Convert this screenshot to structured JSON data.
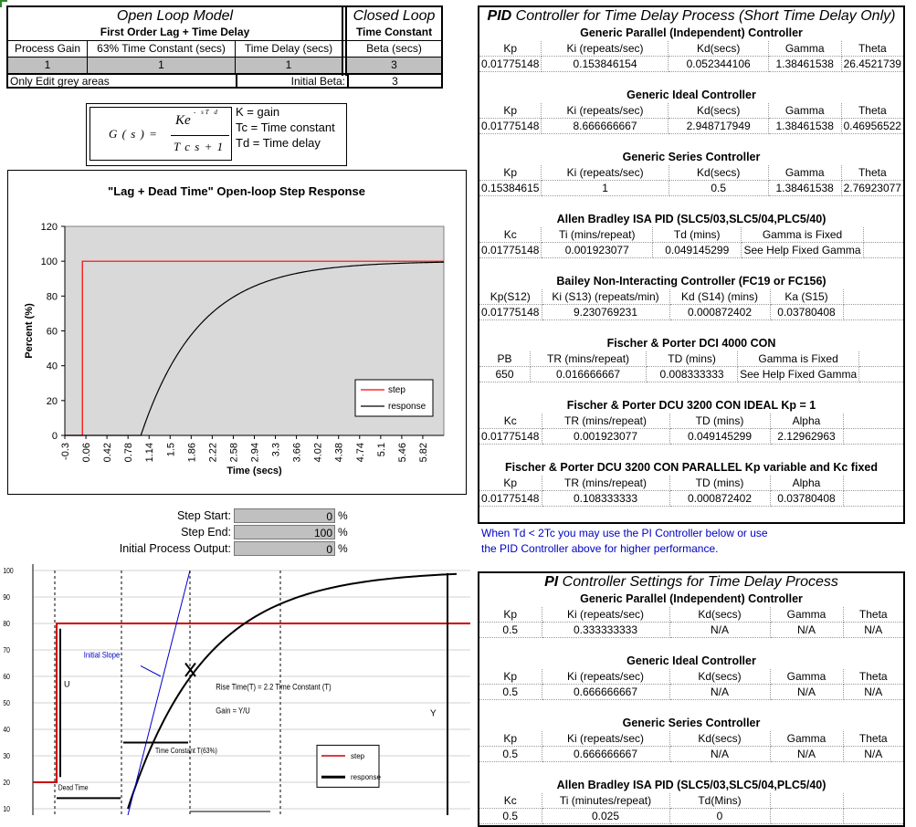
{
  "open_loop": {
    "title": "Open Loop Model",
    "subtitle": "First Order Lag + Time Delay",
    "headers": [
      "Process Gain",
      "63% Time Constant (secs)",
      "Time Delay (secs)"
    ],
    "values": [
      "1",
      "1",
      "1"
    ],
    "note": "Only Edit grey areas",
    "initial_beta_label": "Initial Beta:",
    "initial_beta_value": "3"
  },
  "closed_loop": {
    "title": "Closed Loop",
    "subtitle": "Time Constant",
    "header": "Beta (secs)",
    "value": "3"
  },
  "formula": {
    "g": "G ( s ) =",
    "num": "Ke",
    "exp": "- sT d",
    "den": "T c s + 1",
    "legend": [
      "K = gain",
      "Tc = Time constant",
      "Td = Time delay"
    ]
  },
  "step_inputs": {
    "rows": [
      {
        "label": "Step Start:",
        "value": "0",
        "unit": "%"
      },
      {
        "label": "Step End:",
        "value": "100",
        "unit": "%"
      },
      {
        "label": "Initial Process Output:",
        "value": "0",
        "unit": "%"
      }
    ]
  },
  "pid_panel": {
    "title_bold": "PID",
    "title_rest": " Controller for Time Delay Process (Short Time Delay Only)",
    "sections": [
      {
        "title": "Generic Parallel (Independent) Controller",
        "headers": [
          "Kp",
          "Ki (repeats/sec)",
          "Kd(secs)",
          "Gamma",
          "Theta"
        ],
        "values": [
          "0.01775148",
          "0.153846154",
          "0.052344106",
          "1.38461538",
          "26.4521739"
        ]
      },
      {
        "title": "Generic Ideal Controller",
        "headers": [
          "Kp",
          "Ki (repeats/sec)",
          "Kd(secs)",
          "Gamma",
          "Theta"
        ],
        "values": [
          "0.01775148",
          "8.666666667",
          "2.948717949",
          "1.38461538",
          "0.46956522"
        ]
      },
      {
        "title": "Generic Series Controller",
        "headers": [
          "Kp",
          "Ki (repeats/sec)",
          "Kd(secs)",
          "Gamma",
          "Theta"
        ],
        "values": [
          "0.15384615",
          "1",
          "0.5",
          "1.38461538",
          "2.76923077"
        ]
      },
      {
        "title": "Allen Bradley ISA PID (SLC5/03,SLC5/04,PLC5/40)",
        "headers": [
          "Kc",
          "Ti (mins/repeat)",
          "Td (mins)",
          "Gamma is Fixed",
          ""
        ],
        "values": [
          "0.01775148",
          "0.001923077",
          "0.049145299",
          "See Help Fixed Gamma",
          ""
        ]
      },
      {
        "title": "Bailey Non-Interacting Controller (FC19 or FC156)",
        "headers": [
          "Kp(S12)",
          "Ki (S13) (repeats/min)",
          "Kd (S14) (mins)",
          "Ka (S15)",
          ""
        ],
        "values": [
          "0.01775148",
          "9.230769231",
          "0.000872402",
          "0.03780408",
          ""
        ]
      },
      {
        "title": "Fischer & Porter DCI 4000 CON",
        "headers": [
          "PB",
          "TR (mins/repeat)",
          "TD (mins)",
          "Gamma is Fixed",
          ""
        ],
        "values": [
          "650",
          "0.016666667",
          "0.008333333",
          "See Help Fixed Gamma",
          ""
        ]
      },
      {
        "title": "Fischer & Porter DCU 3200 CON IDEAL Kp = 1",
        "headers": [
          "Kc",
          "TR (mins/repeat)",
          "TD (mins)",
          "Alpha",
          ""
        ],
        "values": [
          "0.01775148",
          "0.001923077",
          "0.049145299",
          "2.12962963",
          ""
        ]
      },
      {
        "title": "Fischer & Porter DCU 3200 CON PARALLEL Kp variable and Kc fixed",
        "headers": [
          "Kp",
          "TR (mins/repeat)",
          "TD (mins)",
          "Alpha",
          ""
        ],
        "values": [
          "0.01775148",
          "0.108333333",
          "0.000872402",
          "0.03780408",
          ""
        ]
      }
    ]
  },
  "note_blue": [
    "When Td < 2Tc you may use the PI Controller below or use",
    "the PID Controller above for higher performance."
  ],
  "pi_panel": {
    "title_bold": "PI",
    "title_rest": " Controller Settings for Time Delay Process",
    "sections": [
      {
        "title": "Generic Parallel (Independent) Controller",
        "headers": [
          "Kp",
          "Ki (repeats/sec)",
          "Kd(secs)",
          "Gamma",
          "Theta"
        ],
        "values": [
          "0.5",
          "0.333333333",
          "N/A",
          "N/A",
          "N/A"
        ]
      },
      {
        "title": "Generic Ideal Controller",
        "headers": [
          "Kp",
          "Ki (repeats/sec)",
          "Kd(secs)",
          "Gamma",
          "Theta"
        ],
        "values": [
          "0.5",
          "0.666666667",
          "N/A",
          "N/A",
          "N/A"
        ]
      },
      {
        "title": "Generic Series Controller",
        "headers": [
          "Kp",
          "Ki (repeats/sec)",
          "Kd(secs)",
          "Gamma",
          "Theta"
        ],
        "values": [
          "0.5",
          "0.666666667",
          "N/A",
          "N/A",
          "N/A"
        ]
      },
      {
        "title": "Allen Bradley ISA PID  (SLC5/03,SLC5/04,PLC5/40)",
        "headers": [
          "Kc",
          "Ti (minutes/repeat)",
          "Td(Mins)",
          "",
          ""
        ],
        "values": [
          "0.5",
          "0.025",
          "0",
          "",
          ""
        ]
      }
    ]
  },
  "chart_data": [
    {
      "type": "line",
      "title": "\"Lag + Dead Time\" Open-loop Step Response",
      "xlabel": "Time (secs)",
      "ylabel": "Percent (%)",
      "xticks": [
        "-0.3",
        "0.06",
        "0.42",
        "0.78",
        "1.14",
        "1.5",
        "1.86",
        "2.22",
        "2.58",
        "2.94",
        "3.3",
        "3.66",
        "4.02",
        "4.38",
        "4.74",
        "5.1",
        "5.46",
        "5.82"
      ],
      "yticks": [
        "0",
        "20",
        "40",
        "60",
        "80",
        "100",
        "120"
      ],
      "xlim": [
        -0.3,
        6.18
      ],
      "ylim": [
        0,
        120
      ],
      "legend_position": "bottom-right",
      "series": [
        {
          "name": "step",
          "color": "#ff0000",
          "x": [
            -0.3,
            0.0,
            0.0,
            6.18
          ],
          "y": [
            0,
            0,
            100,
            100
          ]
        },
        {
          "name": "response",
          "color": "#000000",
          "model": {
            "gain": 1,
            "tau": 1,
            "delay": 1,
            "step_time": 0
          }
        }
      ]
    },
    {
      "type": "line",
      "yticks": [
        "10",
        "20",
        "30",
        "40",
        "50",
        "60",
        "70",
        "80",
        "90",
        "100"
      ],
      "ylim": [
        10,
        100
      ],
      "annotations": [
        "Initial Slope",
        "U",
        "Rise Time(T) = 2.2 Time Constant (T)",
        "Gain = Y/U",
        "Y",
        "Time Constant T(63%)",
        "Dead Time"
      ],
      "legend_entries": [
        "step",
        "response"
      ],
      "legend_position": "right"
    }
  ]
}
